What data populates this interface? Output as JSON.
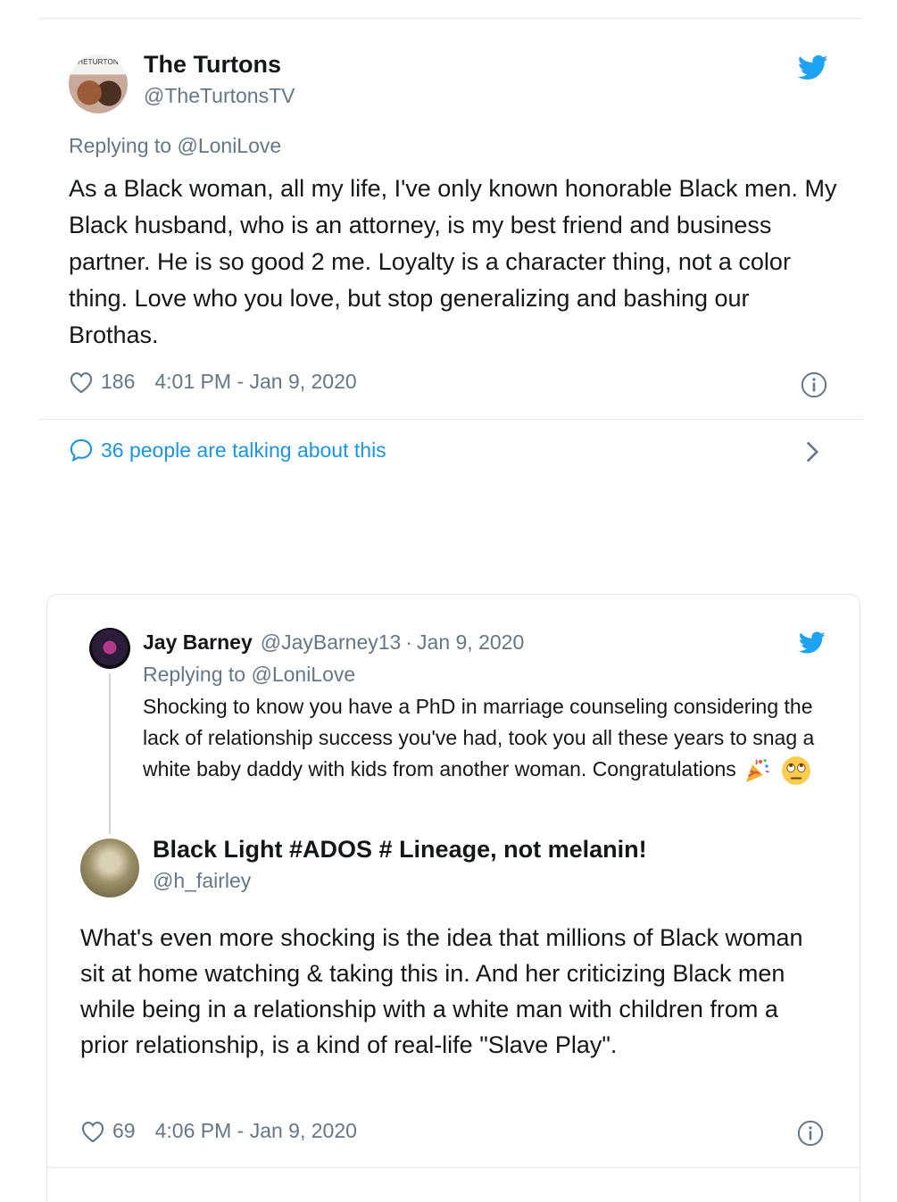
{
  "tweet1": {
    "avatar_label": "HETURTON",
    "display_name": "The Turtons",
    "handle": "@TheTurtonsTV",
    "replying_prefix": "Replying to ",
    "replying_to": "@LoniLove",
    "text": "As a Black woman, all my life, I've only known honorable Black men. My Black husband, who is an attorney, is my best friend and business partner. He is so good 2 me. Loyalty is a character thing, not a color thing. Love who you love, but stop generalizing and bashing our Brothas.",
    "likes": "186",
    "timestamp": "4:01 PM - Jan 9, 2020",
    "talking": "36 people are talking about this"
  },
  "tweet2": {
    "quoted": {
      "display_name": "Jay Barney",
      "handle": "@JayBarney13",
      "dot": "·",
      "date": "Jan 9, 2020",
      "replying_prefix": "Replying to ",
      "replying_to": "@LoniLove",
      "text": "Shocking to know you have a PhD in marriage counseling considering the lack of relationship success you've had, took you all these years to snag a white baby daddy with kids from another woman. Congratulations"
    },
    "display_name": "Black Light #ADOS # Lineage, not melanin!",
    "handle": "@h_fairley",
    "text": "What's even more shocking is the idea that millions of Black woman sit at home watching & taking this in. And her criticizing Black men while being in a relationship with a white man with children from a prior relationship, is a kind of real-life \"Slave Play\".",
    "likes": "69",
    "timestamp": "4:06 PM - Jan 9, 2020"
  },
  "icons": {
    "brand": "twitter-bird-icon",
    "like": "heart-icon",
    "info": "info-icon",
    "conversation": "speech-bubble-icon",
    "expand": "chevron-right-icon",
    "emoji_1": "party-popper-emoji",
    "emoji_2": "eye-roll-emoji"
  },
  "colors": {
    "brand_blue": "#1da1f2",
    "link_blue": "#1b95e0",
    "secondary_text": "#657786",
    "border": "#e1e8ed"
  }
}
